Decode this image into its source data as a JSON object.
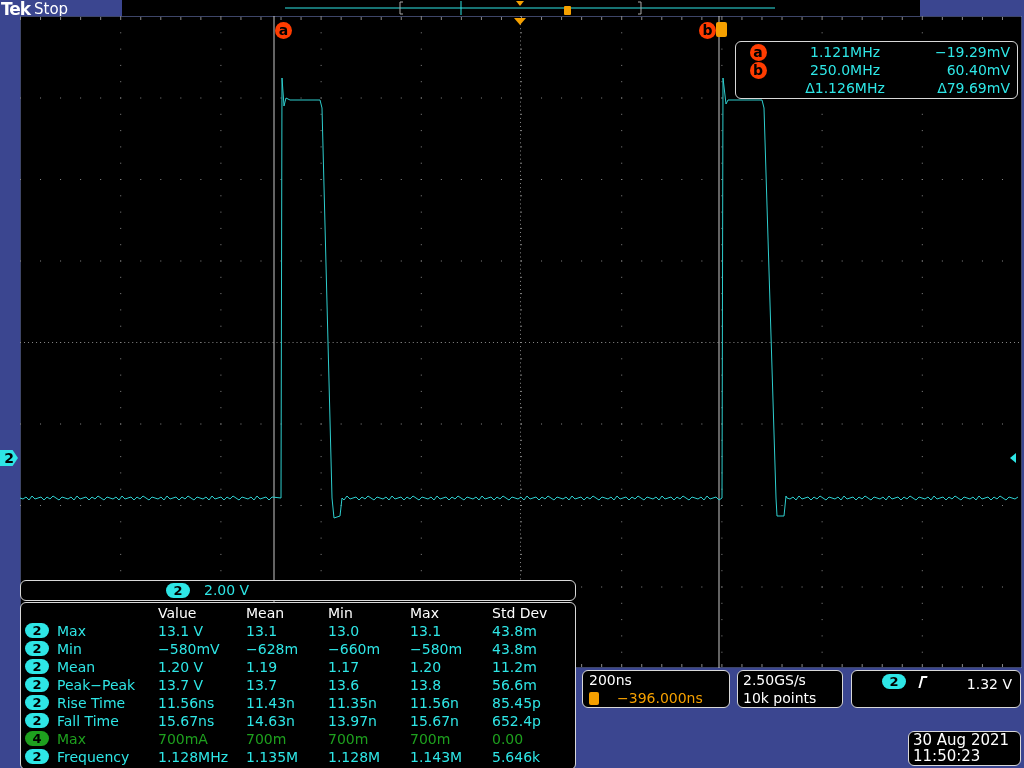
{
  "status": {
    "brand": "Tek",
    "state": "Stop"
  },
  "cursors": [
    {
      "label": "a"
    },
    {
      "label": "b"
    }
  ],
  "cursor_readout": [
    {
      "marker": "a",
      "x": "1.121MHz",
      "y": "−19.29mV"
    },
    {
      "marker": "b",
      "x": "250.0MHz",
      "y": "60.40mV"
    },
    {
      "x": "Δ1.126MHz",
      "y": "Δ79.69mV"
    }
  ],
  "channel_marker": "2",
  "scale": {
    "channel": "2",
    "value": "2.00 V"
  },
  "measurements": {
    "columns": [
      "Value",
      "Mean",
      "Min",
      "Max",
      "Std Dev"
    ],
    "rows": [
      {
        "channel": "2",
        "color": "#2ee6e6",
        "name": "Max",
        "cells": [
          "13.1 V",
          "13.1",
          "13.0",
          "13.1",
          "43.8m"
        ]
      },
      {
        "channel": "2",
        "color": "#2ee6e6",
        "name": "Min",
        "cells": [
          "−580mV",
          "−628m",
          "−660m",
          "−580m",
          "43.8m"
        ]
      },
      {
        "channel": "2",
        "color": "#2ee6e6",
        "name": "Mean",
        "cells": [
          "1.20 V",
          "1.19",
          "1.17",
          "1.20",
          "11.2m"
        ]
      },
      {
        "channel": "2",
        "color": "#2ee6e6",
        "name": "Peak−Peak",
        "cells": [
          "13.7 V",
          "13.7",
          "13.6",
          "13.8",
          "56.6m"
        ]
      },
      {
        "channel": "2",
        "color": "#2ee6e6",
        "name": "Rise Time",
        "cells": [
          "11.56ns",
          "11.43n",
          "11.35n",
          "11.56n",
          "85.45p"
        ]
      },
      {
        "channel": "2",
        "color": "#2ee6e6",
        "name": "Fall Time",
        "cells": [
          "15.67ns",
          "14.63n",
          "13.97n",
          "15.67n",
          "652.4p"
        ]
      },
      {
        "channel": "4",
        "color": "#1ea01e",
        "name": "Max",
        "cells": [
          "700mA",
          "700m",
          "700m",
          "700m",
          "0.00"
        ]
      },
      {
        "channel": "2",
        "color": "#2ee6e6",
        "name": "Frequency",
        "cells": [
          "1.128MHz",
          "1.135M",
          "1.128M",
          "1.143M",
          "5.646k"
        ]
      }
    ]
  },
  "timebase": {
    "scale": "200ns",
    "trigger_position": "−396.000ns"
  },
  "acquisition": {
    "rate": "2.50GS/s",
    "points": "10k points"
  },
  "trigger": {
    "channel": "2",
    "threshold": "1.32 V"
  },
  "datetime": {
    "date": "30 Aug 2021",
    "time": "11:50:23"
  }
}
